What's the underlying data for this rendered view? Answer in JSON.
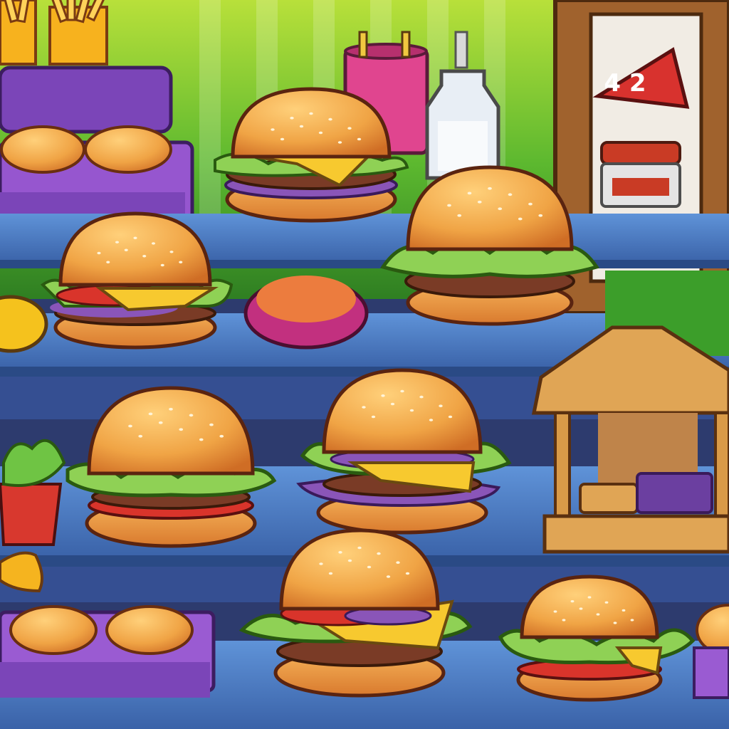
{
  "game": {
    "scene": "burger-shop-counter",
    "menu_sign": {
      "text": "4 2"
    },
    "palette": {
      "bun": "#f0a445",
      "bun_shadow": "#d8772b",
      "lettuce": "#8fd155",
      "cheese": "#f7c92f",
      "tomato": "#d9342b",
      "onion": "#8a55b8",
      "patty": "#7a3b26",
      "shelf": "#4d7fc6",
      "shelf_dark": "#2f4f8f",
      "wall_green": "#3f9b25",
      "tray_purple": "#8e4ec4"
    }
  }
}
